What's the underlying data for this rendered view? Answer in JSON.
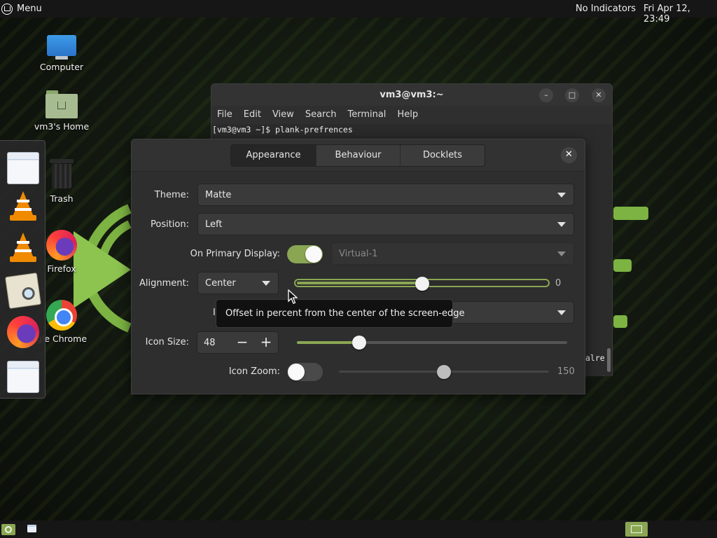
{
  "top_panel": {
    "menu_label": "Menu",
    "indicators": "No Indicators",
    "clock": "Fri Apr 12, 23:49"
  },
  "desktop_icons": [
    {
      "label": "Computer",
      "icon": "computer-icon"
    },
    {
      "label": "vm3's Home",
      "icon": "home-folder-icon"
    },
    {
      "label": "Trash",
      "icon": "trash-icon"
    },
    {
      "label": "Firefox",
      "icon": "firefox-icon"
    },
    {
      "label": "gle Chrome",
      "icon": "chrome-icon"
    }
  ],
  "dock": {
    "items": [
      "window-icon",
      "vlc-icon",
      "vlc-icon",
      "color-picker-icon",
      "firefox-icon",
      "window-icon"
    ]
  },
  "terminal": {
    "title": "vm3@vm3:~",
    "menu": [
      "File",
      "Edit",
      "View",
      "Search",
      "Terminal",
      "Help"
    ],
    "command_line": "[vm3@vm3 ~]$ plank-prefrences",
    "partial_text": "alre"
  },
  "prefs": {
    "tabs": [
      {
        "label": "Appearance",
        "active": true
      },
      {
        "label": "Behaviour",
        "active": false
      },
      {
        "label": "Docklets",
        "active": false
      }
    ],
    "close_label": "✕",
    "theme": {
      "label": "Theme:",
      "value": "Matte"
    },
    "position": {
      "label": "Position:",
      "value": "Left"
    },
    "primary_display": {
      "label": "On Primary Display:",
      "enabled": true,
      "value": "Virtual-1"
    },
    "alignment": {
      "label": "Alignment:",
      "value": "Center",
      "offset_value": "0",
      "offset_fraction": 0.5
    },
    "icon_alignment": {
      "label_visible": "Ic"
    },
    "icon_size": {
      "label": "Icon Size:",
      "value": "48",
      "minus": "−",
      "plus": "+",
      "slider_fraction": 0.23
    },
    "icon_zoom": {
      "label": "Icon Zoom:",
      "enabled": false,
      "value": "150",
      "slider_fraction": 0.5
    },
    "tooltip": "Offset in percent from the center of the screen-edge"
  },
  "colors": {
    "accent": "#8aa653",
    "panel": "#161616",
    "dialog_bg": "#2e2e2e"
  }
}
